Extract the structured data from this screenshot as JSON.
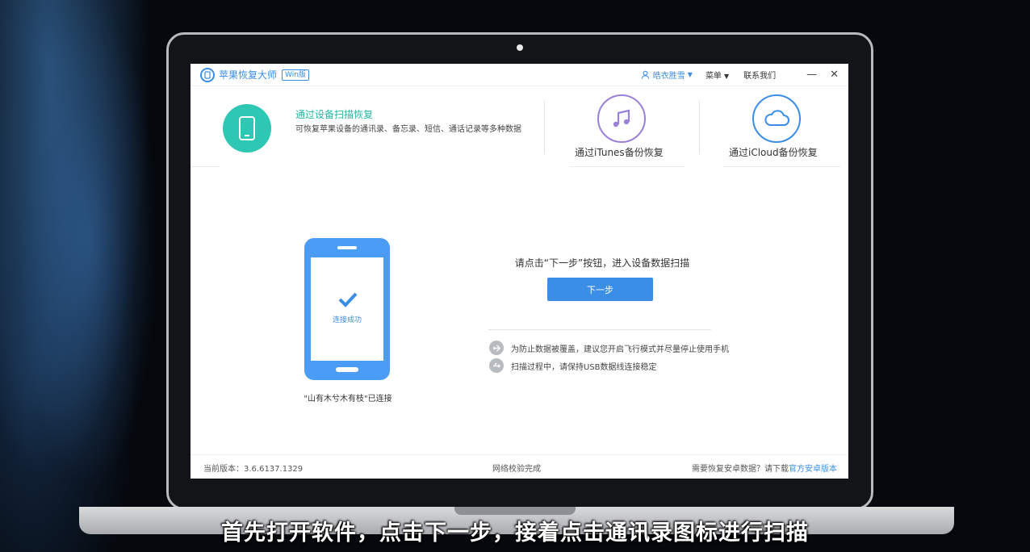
{
  "app": {
    "name": "苹果恢复大师",
    "edition": "Win版"
  },
  "header": {
    "user": "皓衣胜雪",
    "menu": "菜单",
    "contact": "联系我们"
  },
  "tabs": {
    "device": {
      "title": "通过设备扫描恢复",
      "desc": "可恢复苹果设备的通讯录、备忘录、短信、通话记录等多种数据"
    },
    "itunes": {
      "label": "通过iTunes备份恢复"
    },
    "icloud": {
      "label": "通过iCloud备份恢复"
    }
  },
  "device": {
    "connected_text": "连接成功",
    "status": "\"山有木兮木有枝\"已连接"
  },
  "main": {
    "prompt": "请点击“下一步”按钮，进入设备数据扫描",
    "next_label": "下一步",
    "tips": [
      "为防止数据被覆盖，建议您开启飞行模式并尽量停止使用手机",
      "扫描过程中，请保持USB数据线连接稳定"
    ]
  },
  "status": {
    "version": "当前版本：3.6.6137.1329",
    "network": "网络校验完成",
    "android_prefix": "需要恢复安卓数据？请下载",
    "android_link": "官方安卓版本"
  },
  "caption": "首先打开软件，点击下一步，接着点击通讯录图标进行扫描",
  "colors": {
    "accent": "#3a8ee6",
    "teal": "#2ec7b4",
    "purple": "#9b80d8"
  }
}
